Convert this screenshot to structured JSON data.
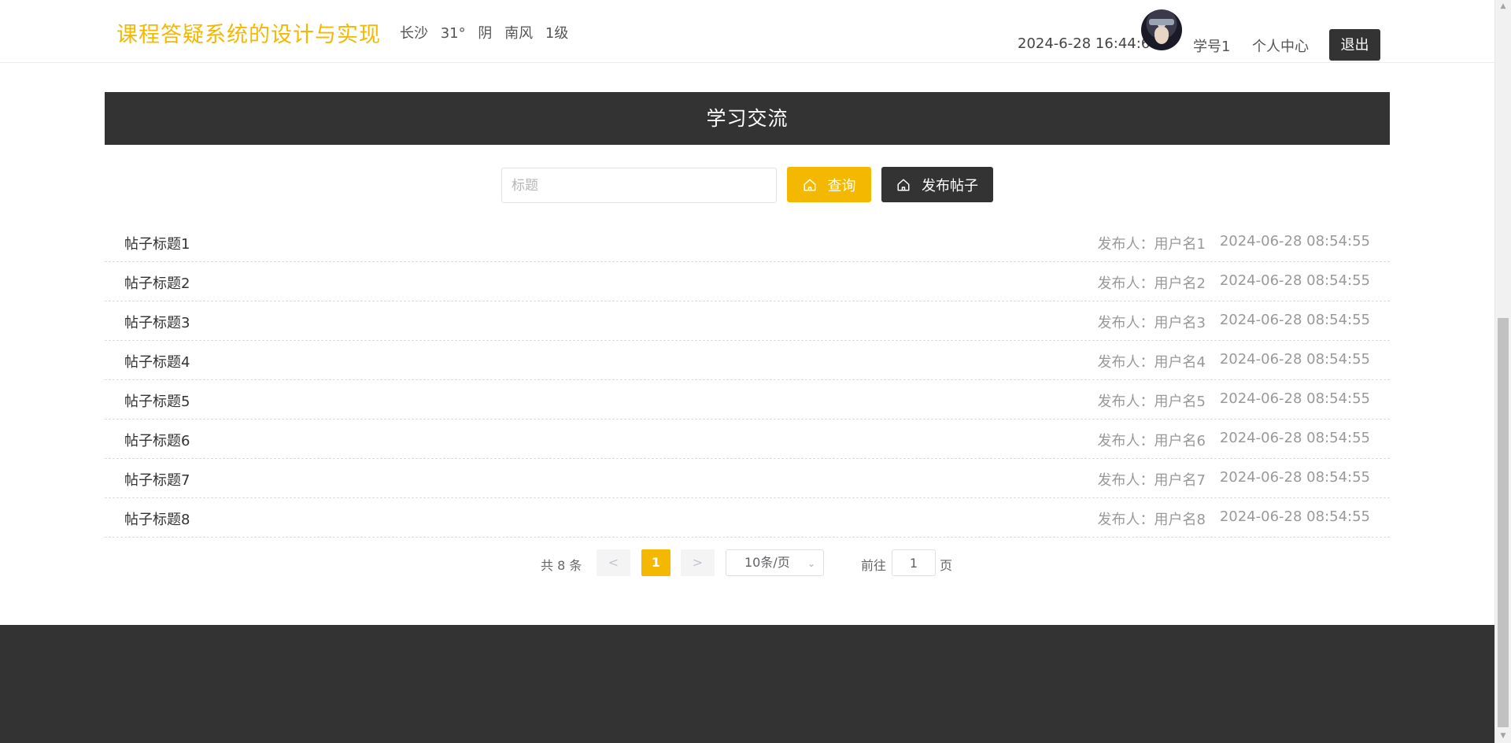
{
  "header": {
    "site_title": "课程答疑系统的设计与实现",
    "weather": {
      "city": "长沙",
      "temperature": "31°",
      "condition": "阴",
      "wind": "南风",
      "level": "1级"
    },
    "datetime": "2024-6-28 16:44:6",
    "user_label": "学号1",
    "center_label": "个人中心",
    "logout_label": "退出"
  },
  "banner": {
    "title": "学习交流"
  },
  "search": {
    "placeholder": "标题",
    "query_label": "查询",
    "post_label": "发布帖子"
  },
  "posts": [
    {
      "title": "帖子标题1",
      "author": "发布人：用户名1",
      "time": "2024-06-28 08:54:55"
    },
    {
      "title": "帖子标题2",
      "author": "发布人：用户名2",
      "time": "2024-06-28 08:54:55"
    },
    {
      "title": "帖子标题3",
      "author": "发布人：用户名3",
      "time": "2024-06-28 08:54:55"
    },
    {
      "title": "帖子标题4",
      "author": "发布人：用户名4",
      "time": "2024-06-28 08:54:55"
    },
    {
      "title": "帖子标题5",
      "author": "发布人：用户名5",
      "time": "2024-06-28 08:54:55"
    },
    {
      "title": "帖子标题6",
      "author": "发布人：用户名6",
      "time": "2024-06-28 08:54:55"
    },
    {
      "title": "帖子标题7",
      "author": "发布人：用户名7",
      "time": "2024-06-28 08:54:55"
    },
    {
      "title": "帖子标题8",
      "author": "发布人：用户名8",
      "time": "2024-06-28 08:54:55"
    }
  ],
  "pagination": {
    "total_text": "共 8 条",
    "prev_label": "<",
    "current_page": "1",
    "next_label": ">",
    "page_size": "10条/页",
    "goto_label": "前往",
    "goto_value": "1",
    "page_suffix": "页"
  },
  "colors": {
    "accent": "#f5b800",
    "dark": "#333333"
  },
  "icons": {
    "query": "home-icon",
    "post": "home-icon",
    "dropdown": "chevron-down-icon"
  },
  "scroll": {
    "position_fraction": 1.0
  }
}
